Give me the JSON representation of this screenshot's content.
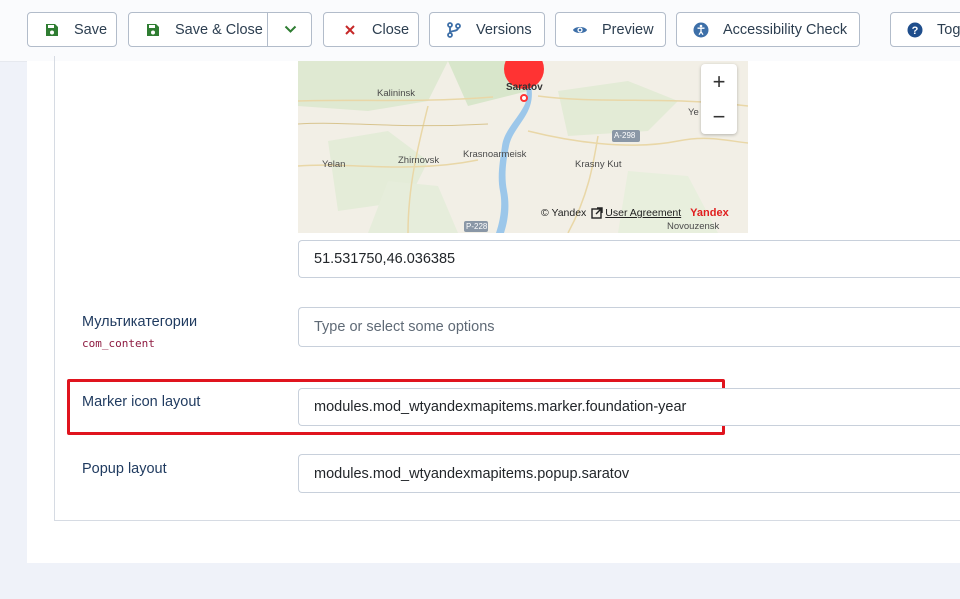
{
  "toolbar": {
    "save": "Save",
    "save_close": "Save & Close",
    "close": "Close",
    "versions": "Versions",
    "preview": "Preview",
    "accessibility": "Accessibility Check",
    "toggle": "Toggle"
  },
  "map": {
    "cities": {
      "saratov": "Saratov",
      "kalininsk": "Kalininsk",
      "yelan": "Yelan",
      "zhirnovsk": "Zhirnovsk",
      "krasnoarmeisk": "Krasnoarmeisk",
      "krasny_kut": "Krasny Kut",
      "novouzensk": "Novouzensk",
      "ye": "Ye"
    },
    "roads": {
      "a298": "A-298",
      "p228": "P-228"
    },
    "copyright": "© Yandex",
    "user_agreement": "User Agreement",
    "brand": "Yandex",
    "zoom_in": "+",
    "zoom_out": "−",
    "coordinates": "51.531750,46.036385"
  },
  "fields": {
    "multicategory": {
      "label": "Мультикатегории",
      "sublabel": "com_content",
      "placeholder": "Type or select some options"
    },
    "marker_layout": {
      "label": "Marker icon layout",
      "value": "modules.mod_wtyandexmapitems.marker.foundation-year"
    },
    "popup_layout": {
      "label": "Popup layout",
      "value": "modules.mod_wtyandexmapitems.popup.saratov"
    }
  },
  "colors": {
    "save_icon": "#2f7d32",
    "close_icon": "#c62828",
    "toolbar_icon": "#3d6fa8",
    "highlight": "#e0141e",
    "map_marker": "#ff3333"
  }
}
